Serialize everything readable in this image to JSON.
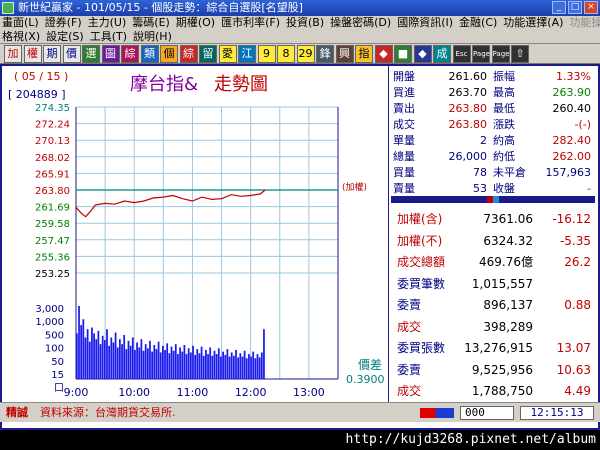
{
  "window": {
    "title": "新世紀贏家 - 101/05/15 - 個股走勢：綜合自選股[名望股]",
    "buttons": [
      "_",
      "□",
      "×"
    ]
  },
  "menu": {
    "row1": [
      "畫面(L)",
      "證券(F)",
      "主力(U)",
      "籌碼(E)",
      "期權(O)",
      "匯市利率(F)",
      "投資(B)",
      "操盤密碼(D)",
      "國際資訊(I)",
      "金融(C)",
      "功能選擇(A)",
      "功能操作(E)"
    ],
    "row2": [
      "格視(X)",
      "設定(S)",
      "工具(T)",
      "說明(H)"
    ]
  },
  "toolbar": {
    "buttons": [
      {
        "label": "加",
        "color": "#c00000",
        "bg": "#e8e8e8"
      },
      {
        "label": "權",
        "color": "#c00000",
        "bg": "#e8e8e8"
      },
      {
        "label": "期",
        "color": "#000080",
        "bg": "#e8e8e8"
      },
      {
        "label": "價",
        "color": "#000080",
        "bg": "#e8e8e8"
      },
      {
        "label": "選",
        "color": "#ffffff",
        "bg": "#2e7d32"
      },
      {
        "label": "圖",
        "color": "#ffffff",
        "bg": "#6a1b9a"
      },
      {
        "label": "綜",
        "color": "#ffffff",
        "bg": "#ad1457"
      },
      {
        "label": "類",
        "color": "#ffffff",
        "bg": "#1565c0"
      },
      {
        "label": "個",
        "color": "#000000",
        "bg": "#f9a825"
      },
      {
        "label": "綜",
        "color": "#ffffff",
        "bg": "#c62828"
      },
      {
        "label": "留",
        "color": "#ffffff",
        "bg": "#00695c"
      },
      {
        "label": "愛",
        "color": "#000000",
        "bg": "#ffeb3b"
      },
      {
        "label": "江",
        "color": "#ffffff",
        "bg": "#0277bd"
      },
      {
        "label": "9",
        "color": "#000000",
        "bg": "#ffeb3b"
      },
      {
        "label": "8",
        "color": "#000000",
        "bg": "#ffeb3b"
      },
      {
        "label": "29",
        "color": "#000000",
        "bg": "#ffeb3b"
      },
      {
        "label": "鋒",
        "color": "#ffffff",
        "bg": "#455a64"
      },
      {
        "label": "興",
        "color": "#ffffff",
        "bg": "#5d4037"
      },
      {
        "label": "指",
        "color": "#000000",
        "bg": "#fbc02d"
      },
      {
        "label": "◆",
        "color": "#ffffff",
        "bg": "#c62828"
      },
      {
        "label": "■",
        "color": "#ffffff",
        "bg": "#2e7d32"
      },
      {
        "label": "◆",
        "color": "#ffffff",
        "bg": "#283593"
      },
      {
        "label": "成",
        "color": "#ffffff",
        "bg": "#00838f"
      },
      {
        "label": "Esc",
        "color": "#ffffff",
        "bg": "#303030"
      },
      {
        "label": "Page",
        "color": "#ffffff",
        "bg": "#303030"
      },
      {
        "label": "Page",
        "color": "#ffffff",
        "bg": "#303030"
      },
      {
        "label": "⇧",
        "color": "#ffffff",
        "bg": "#303030"
      }
    ]
  },
  "chart": {
    "date_label": "( 05 / 15 )",
    "volume_label": "[ 204889 ]",
    "title_part1": "摩台指&",
    "title_part2": "走勢圖",
    "ref_tag": "(加權)",
    "spread_label": "價差",
    "spread_value": "0.3900",
    "volume_ticks": [
      "3,000",
      "1,000",
      "500",
      "100",
      "50",
      "15",
      "口"
    ]
  },
  "chart_data": {
    "type": "line",
    "title": "摩台指& 走勢圖",
    "x_ticks": [
      "9:00",
      "10:00",
      "11:00",
      "12:00",
      "13:00"
    ],
    "y_ticks": [
      {
        "label": "274.35",
        "color": "#008080"
      },
      {
        "label": "272.24",
        "color": "#c00000"
      },
      {
        "label": "270.13",
        "color": "#c00000"
      },
      {
        "label": "268.02",
        "color": "#c00000"
      },
      {
        "label": "265.91",
        "color": "#c00000"
      },
      {
        "label": "263.80",
        "color": "#c00000"
      },
      {
        "label": "261.69",
        "color": "#008000"
      },
      {
        "label": "259.58",
        "color": "#008000"
      },
      {
        "label": "257.47",
        "color": "#008000"
      },
      {
        "label": "255.36",
        "color": "#008000"
      },
      {
        "label": "253.25",
        "color": "#000000"
      }
    ],
    "ylim": [
      253.25,
      274.35
    ],
    "reference": 263.8,
    "price_series": {
      "name": "摩台指",
      "x_minutes": [
        0,
        5,
        10,
        15,
        20,
        30,
        40,
        50,
        60,
        70,
        80,
        90,
        100,
        110,
        120,
        130,
        140,
        150,
        160,
        170,
        180,
        190,
        195
      ],
      "values": [
        261.6,
        260.9,
        260.4,
        261.1,
        261.9,
        262.1,
        262.0,
        262.4,
        262.2,
        262.4,
        262.8,
        262.9,
        263.1,
        262.7,
        262.4,
        262.9,
        262.6,
        262.7,
        263.2,
        263.0,
        263.1,
        263.3,
        263.8
      ]
    },
    "volume_series": {
      "name": "成交量",
      "levels": [
        0.55,
        0.88,
        0.65,
        0.72,
        0.5,
        0.6,
        0.45,
        0.62,
        0.55,
        0.48,
        0.58,
        0.42,
        0.52,
        0.47,
        0.6,
        0.4,
        0.5,
        0.44,
        0.56,
        0.38,
        0.48,
        0.42,
        0.53,
        0.36,
        0.46,
        0.4,
        0.5,
        0.35,
        0.44,
        0.38,
        0.48,
        0.34,
        0.42,
        0.37,
        0.46,
        0.33,
        0.41,
        0.36,
        0.45,
        0.32,
        0.4,
        0.35,
        0.43,
        0.31,
        0.39,
        0.34,
        0.42,
        0.3,
        0.38,
        0.33,
        0.41,
        0.3,
        0.37,
        0.32,
        0.4,
        0.29,
        0.36,
        0.31,
        0.39,
        0.28,
        0.35,
        0.3,
        0.38,
        0.28,
        0.34,
        0.3,
        0.37,
        0.27,
        0.33,
        0.29,
        0.36,
        0.27,
        0.32,
        0.28,
        0.35,
        0.26,
        0.31,
        0.27,
        0.34,
        0.25,
        0.3,
        0.27,
        0.33,
        0.25,
        0.3,
        0.26,
        0.32,
        0.6
      ]
    }
  },
  "quote": {
    "rows": [
      {
        "l1": "開盤",
        "v1": "261.60",
        "v1c": "#000000",
        "l2": "振幅",
        "v2": "1.33%",
        "v2c": "#c00000"
      },
      {
        "l1": "買進",
        "v1": "263.70",
        "v1c": "#000000",
        "l2": "最高",
        "v2": "263.90",
        "v2c": "#008000"
      },
      {
        "l1": "賣出",
        "v1": "263.80",
        "v1c": "#c00000",
        "l2": "最低",
        "v2": "260.40",
        "v2c": "#000000"
      },
      {
        "l1": "成交",
        "v1": "263.80",
        "v1c": "#c00000",
        "l2": "漲跌",
        "v2": "-(-)",
        "v2c": "#c00000"
      },
      {
        "l1": "單量",
        "v1": "2",
        "v1c": "#000080",
        "l2": "約高",
        "v2": "282.40",
        "v2c": "#c00000"
      },
      {
        "l1": "總量",
        "v1": "26,000",
        "v1c": "#000080",
        "l2": "約低",
        "v2": "262.00",
        "v2c": "#c00000"
      },
      {
        "l1": "買量",
        "v1": "78",
        "v1c": "#000080",
        "l2": "未平倉",
        "v2": "157,963",
        "v2c": "#000080"
      },
      {
        "l1": "賣量",
        "v1": "53",
        "v1c": "#000080",
        "l2": "收盤",
        "v2": "-",
        "v2c": "#c00000"
      }
    ]
  },
  "market": {
    "rows": [
      {
        "label": "加權(含)",
        "lc": "#c00000",
        "value": "7361.06",
        "change": "-16.12"
      },
      {
        "label": "加權(不)",
        "lc": "#c00000",
        "value": "6324.32",
        "change": "-5.35"
      },
      {
        "label": "成交總額",
        "lc": "#c00000",
        "value": "469.76億",
        "change": "26.2"
      },
      {
        "label": "委買筆數",
        "lc": "#000080",
        "value": "1,015,557",
        "change": ""
      },
      {
        "label": "委賣",
        "lc": "#000080",
        "value": "896,137",
        "change": "0.88"
      },
      {
        "label": "成交",
        "lc": "#c00000",
        "value": "398,289",
        "change": ""
      },
      {
        "label": "委買張數",
        "lc": "#000080",
        "value": "13,276,915",
        "change": "13.07"
      },
      {
        "label": "委賣",
        "lc": "#000080",
        "value": "9,525,956",
        "change": "10.63"
      },
      {
        "label": "成交",
        "lc": "#c00000",
        "value": "1,788,750",
        "change": "4.49"
      }
    ]
  },
  "status": {
    "tag": "精誠",
    "source": "資料來源：台灣期貨交易所.",
    "input_value": "000",
    "time": "12:15:13"
  },
  "watermark": "http://kujd3268.pixnet.net/album"
}
